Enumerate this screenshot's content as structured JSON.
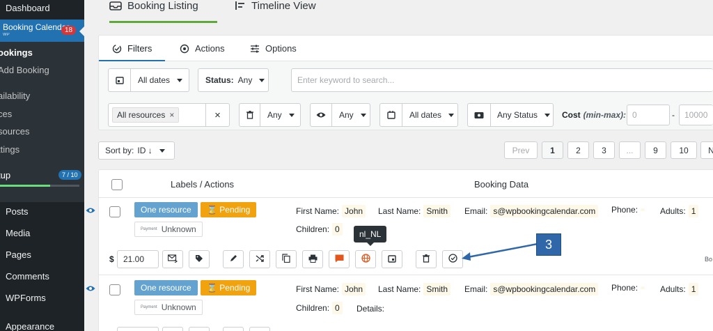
{
  "sidebar": {
    "dashboard": "Dashboard",
    "booking_calendar": "Booking Calendar",
    "booking_calendar_sub": "WP",
    "booking_calendar_badge": "18",
    "sub_items": [
      "Bookings",
      "Add Booking",
      "Availability",
      "Prices",
      "Resources",
      "Settings"
    ],
    "sub_visible": [
      "ookings",
      "Add Booking",
      "ailability",
      "ces",
      "sources",
      "ttings"
    ],
    "setup": "tup",
    "setup_badge": "7 / 10",
    "setup_progress": 0.63,
    "main_items": [
      "Posts",
      "Media",
      "Pages",
      "Comments",
      "WPForms",
      "Appearance"
    ]
  },
  "top_tabs": [
    {
      "label": "Booking Listing",
      "icon": "inbox-icon",
      "active": true
    },
    {
      "label": "Timeline View",
      "icon": "timeline-icon",
      "active": false
    }
  ],
  "subtabs": [
    {
      "label": "Filters",
      "icon": "filter-icon"
    },
    {
      "label": "Actions",
      "icon": "target-icon"
    },
    {
      "label": "Options",
      "icon": "sliders-icon"
    }
  ],
  "filters": {
    "dates": "All dates",
    "status_label": "Status:",
    "status_value": "Any",
    "search_placeholder": "Enter keyword to search...",
    "resources_tag": "All resources",
    "trash_value": "Any",
    "read_value": "Any",
    "booking_dates": "All dates",
    "payment_status": "Any Status",
    "cost_label": "Cost",
    "cost_hint": "(min-max):",
    "cost_min_placeholder": "0",
    "cost_dash": "-",
    "cost_max_placeholder": "10000"
  },
  "sort": {
    "label": "Sort by:",
    "value": "ID ↓"
  },
  "pagination": [
    "Prev",
    "1",
    "2",
    "3",
    "...",
    "9",
    "10",
    "N"
  ],
  "table": {
    "col_labels": "Labels / Actions",
    "col_data": "Booking Data"
  },
  "bookings": [
    {
      "resource": "One resource",
      "status": "Pending",
      "payment_label": "Payment",
      "payment_status": "Unknown",
      "first_name_label": "First Name:",
      "first_name": "John",
      "last_name_label": "Last Name:",
      "last_name": "Smith",
      "email_label": "Email:",
      "email": "s@wpbookingcalendar.com",
      "phone_label": "Phone:",
      "adults_label": "Adults:",
      "adults": "1",
      "children_label": "Children:",
      "children": "0",
      "cost_currency": "$",
      "cost": "21.00",
      "right_cut": "Bo"
    },
    {
      "resource": "One resource",
      "status": "Pending",
      "payment_label": "Payment",
      "payment_status": "Unknown",
      "first_name_label": "First Name:",
      "first_name": "John",
      "last_name_label": "Last Name:",
      "last_name": "Smith",
      "email_label": "Email:",
      "email": "s@wpbookingcalendar.com",
      "phone_label": "Phone:",
      "adults_label": "Adults:",
      "adults": "1",
      "children_label": "Children:",
      "children": "0",
      "details_label": "Details:"
    }
  ],
  "tooltip": "nl_NL",
  "callout": "3"
}
